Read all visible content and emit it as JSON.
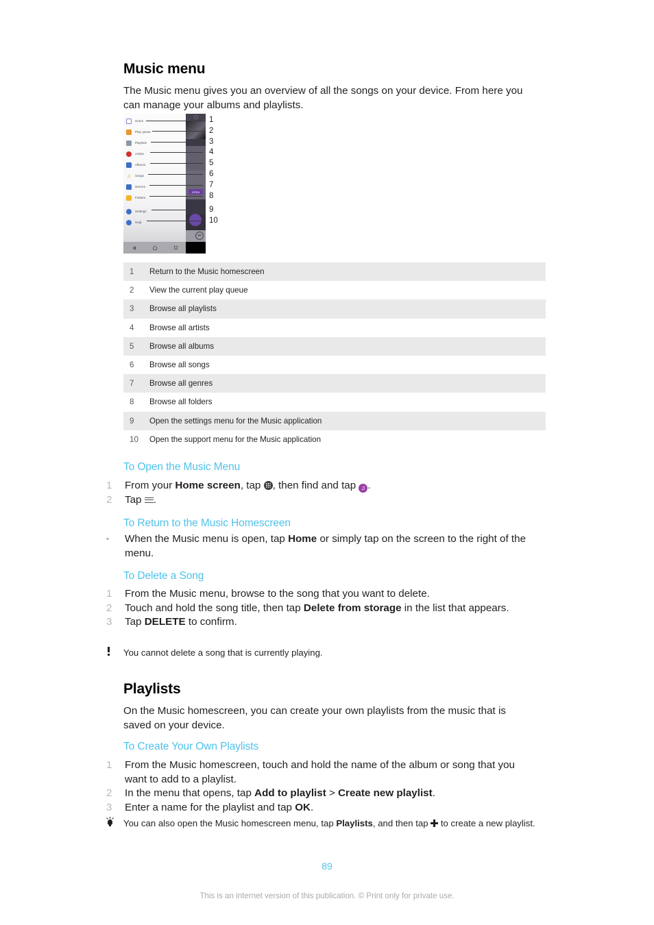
{
  "document": {
    "section_title": "Music menu",
    "intro": "The Music menu gives you an overview of all the songs on your device. From here you can manage your albums and playlists.",
    "page_number": "89",
    "footer": "This is an internet version of this publication. © Print only for private use."
  },
  "phone": {
    "menu_items": [
      {
        "label": "Home",
        "icon": "home-icon",
        "color": "#8e7cc3"
      },
      {
        "label": "Play queue",
        "icon": "play-queue-icon",
        "color": "#e8962f"
      },
      {
        "label": "Playlists",
        "icon": "playlists-icon",
        "color": "#7b8794"
      },
      {
        "label": "Artists",
        "icon": "artists-icon",
        "color": "#d32f2f"
      },
      {
        "label": "Albums",
        "icon": "albums-icon",
        "color": "#3f6fc4"
      },
      {
        "label": "Songs",
        "icon": "songs-icon",
        "color": "#e8a33d"
      },
      {
        "label": "Genres",
        "icon": "genres-icon",
        "color": "#3f6fc4"
      },
      {
        "label": "Folders",
        "icon": "folders-icon",
        "color": "#f0b429"
      },
      {
        "label": "Settings",
        "icon": "settings-icon",
        "color": "#3f6fc4"
      },
      {
        "label": "Help",
        "icon": "help-icon",
        "color": "#3f6fc4"
      }
    ],
    "right_panel": {
      "open_button": "OPEN"
    },
    "nav_bar": [
      "back-icon",
      "home-icon",
      "recents-icon"
    ]
  },
  "callouts": [
    "1",
    "2",
    "3",
    "4",
    "5",
    "6",
    "7",
    "8",
    "9",
    "10"
  ],
  "legend_table": {
    "rows": [
      {
        "num": "1",
        "desc": "Return to the Music homescreen"
      },
      {
        "num": "2",
        "desc": "View the current play queue"
      },
      {
        "num": "3",
        "desc": "Browse all playlists"
      },
      {
        "num": "4",
        "desc": "Browse all artists"
      },
      {
        "num": "5",
        "desc": "Browse all albums"
      },
      {
        "num": "6",
        "desc": "Browse all songs"
      },
      {
        "num": "7",
        "desc": "Browse all genres"
      },
      {
        "num": "8",
        "desc": "Browse all folders"
      },
      {
        "num": "9",
        "desc": "Open the settings menu for the Music application"
      },
      {
        "num": "10",
        "desc": "Open the support menu for the Music application"
      }
    ]
  },
  "procedures": {
    "open_music_menu": {
      "heading": "To Open the Music Menu",
      "step1_a": "From your ",
      "step1_b": "Home screen",
      "step1_c": ", tap ",
      "step1_d": ", then find and tap ",
      "step1_e": ".",
      "step2_a": "Tap ",
      "step2_b": ".",
      "numbers": [
        "1",
        "2"
      ]
    },
    "return_homescreen": {
      "heading": "To Return to the Music Homescreen",
      "bullet_a": "When the Music menu is open, tap ",
      "bullet_b": "Home",
      "bullet_c": " or simply tap on the screen to the right of the menu.",
      "bullet_marker": "•"
    },
    "delete_song": {
      "heading": "To Delete a Song",
      "numbers": [
        "1",
        "2",
        "3"
      ],
      "step1": "From the Music menu, browse to the song that you want to delete.",
      "step2_a": "Touch and hold the song title, then tap ",
      "step2_b": "Delete from storage",
      "step2_c": " in the list that appears.",
      "step3_a": "Tap ",
      "step3_b": "DELETE",
      "step3_c": " to confirm.",
      "warning_icon": "exclamation-icon",
      "warning": "You cannot delete a song that is currently playing."
    }
  },
  "playlists": {
    "title": "Playlists",
    "intro": "On the Music homescreen, you can create your own playlists from the music that is saved on your device.",
    "create": {
      "heading": "To Create Your Own Playlists",
      "numbers": [
        "1",
        "2",
        "3"
      ],
      "step1": "From the Music homescreen, touch and hold the name of the album or song that you want to add to a playlist.",
      "step2_a": "In the menu that opens, tap ",
      "step2_b": "Add to playlist",
      "step2_c": " > ",
      "step2_d": "Create new playlist",
      "step2_e": ".",
      "step3_a": "Enter a name for the playlist and tap ",
      "step3_b": "OK",
      "step3_c": ".",
      "tip_icon": "lightbulb-icon",
      "tip_a": "You can also open the Music homescreen menu, tap ",
      "tip_b": "Playlists",
      "tip_c": ", and then tap ",
      "tip_d": " to create a new playlist."
    }
  },
  "colors": {
    "accent_heading": "#4FC2E9",
    "table_shade": "#e9e9e9",
    "list_number": "#b6b8ba",
    "footer_text": "#a7a9ac"
  }
}
